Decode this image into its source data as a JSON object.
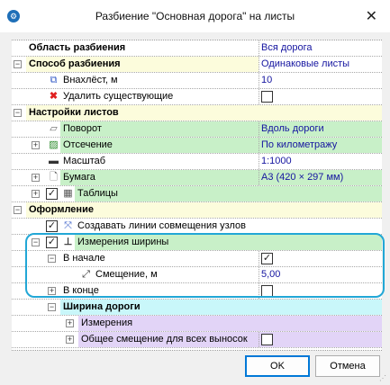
{
  "window": {
    "title": "Разбиение \"Основная дорога\" на листы",
    "app_icon": "app-logo-icon",
    "close_glyph": "✕"
  },
  "grid": {
    "rows": [
      {
        "label": "Область разбиения",
        "value": "Вся дорога"
      },
      {
        "label": "Способ разбиения",
        "value": "Одинаковые листы"
      },
      {
        "label": "Внахлёст, м",
        "value": "10"
      },
      {
        "label": "Удалить существующие",
        "checked": false
      },
      {
        "label": "Настройки листов"
      },
      {
        "label": "Поворот",
        "value": "Вдоль дороги"
      },
      {
        "label": "Отсечение",
        "value": "По километражу"
      },
      {
        "label": "Масштаб",
        "value": "1:1000"
      },
      {
        "label": "Бумага",
        "value": "А3 (420 × 297 мм)"
      },
      {
        "label": "Таблицы",
        "checked": true
      },
      {
        "label": "Оформление"
      },
      {
        "label": "Создавать линии совмещения узлов",
        "checked": true
      },
      {
        "label": "Измерения ширины",
        "checked": true
      },
      {
        "label": "В начале",
        "checked": true
      },
      {
        "label": "Смещение, м",
        "value": "5,00"
      },
      {
        "label": "В конце",
        "checked": false
      },
      {
        "label": "Ширина дороги"
      },
      {
        "label": "Измерения"
      },
      {
        "label": "Общее смещение для всех выносок",
        "checked": false
      }
    ]
  },
  "buttons": {
    "ok": "OK",
    "cancel": "Отмена"
  },
  "colors": {
    "green": "#c8f0c8",
    "cyan": "#c9f7fa",
    "purple": "#e2d4f7",
    "focus": "#22a7d6"
  }
}
